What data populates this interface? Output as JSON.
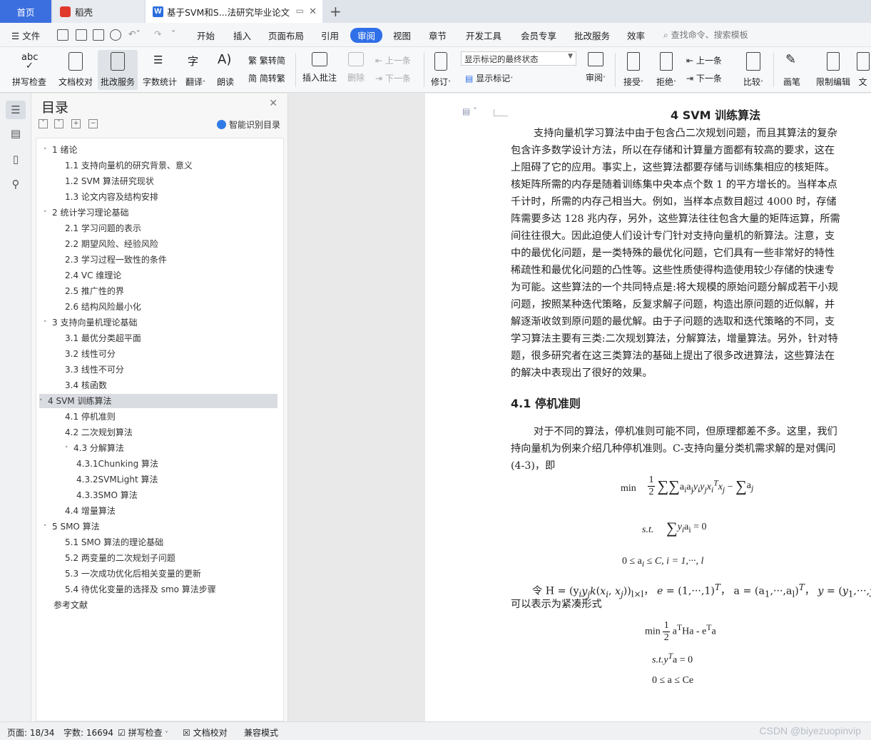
{
  "tabs": {
    "home": "首页",
    "wps": "稻壳",
    "doc": "基于SVM和S...法研究毕业论文"
  },
  "menu": {
    "file": "文件",
    "items": [
      "开始",
      "插入",
      "页面布局",
      "引用",
      "审阅",
      "视图",
      "章节",
      "开发工具",
      "会员专享",
      "批改服务",
      "效率"
    ],
    "active": "审阅",
    "search": "查找命令、搜索模板"
  },
  "ribbon": {
    "spell_check": "拼写检查",
    "doc_proof": "文档校对",
    "revise_service": "批改服务",
    "word_count": "字数统计",
    "translate": "翻译",
    "read_aloud": "朗读",
    "to_traditional": "繁转简",
    "to_simplified": "简转繁",
    "insert_comment": "插入批注",
    "delete": "删除",
    "prev_comment": "上一条",
    "next_comment": "下一条",
    "track_changes": "修订",
    "markup_state": "显示标记的最终状态",
    "show_markup": "显示标记",
    "review": "审阅",
    "accept": "接受",
    "reject": "拒绝",
    "prev_change": "上一条",
    "next_change": "下一条",
    "compare": "比较",
    "pen": "画笔",
    "restrict": "限制编辑",
    "more": "文"
  },
  "toc": {
    "title": "目录",
    "smart": "智能识别目录",
    "items": [
      {
        "label": "1  绪论",
        "level": 1,
        "caret": "˅"
      },
      {
        "label": "1.1 支持向量机的研究背景、意义",
        "level": 2
      },
      {
        "label": "1.2 SVM 算法研究现状",
        "level": 2
      },
      {
        "label": "1.3  论文内容及结构安排",
        "level": 2
      },
      {
        "label": "2  统计学习理论基础",
        "level": 1,
        "caret": "˅"
      },
      {
        "label": "2.1  学习问题的表示",
        "level": 2
      },
      {
        "label": "2.2  期望风险、经验风险",
        "level": 2
      },
      {
        "label": "2.3  学习过程一致性的条件",
        "level": 2
      },
      {
        "label": "2.4 VC 维理论",
        "level": 2
      },
      {
        "label": "2.5  推广性的界",
        "level": 2
      },
      {
        "label": "2.6  结构风险最小化",
        "level": 2
      },
      {
        "label": "3  支持向量机理论基础",
        "level": 1,
        "caret": "˅"
      },
      {
        "label": "3.1  最优分类超平面",
        "level": 2
      },
      {
        "label": "3.2  线性可分",
        "level": 2
      },
      {
        "label": "3.3  线性不可分",
        "level": 2
      },
      {
        "label": "3.4  核函数",
        "level": 2
      },
      {
        "label": "4 SVM 训练算法",
        "level": 1,
        "caret": "˅",
        "highlight": true
      },
      {
        "label": "4.1  停机准则",
        "level": 2
      },
      {
        "label": "4.2  二次规划算法",
        "level": 2
      },
      {
        "label": "4.3  分解算法",
        "level": 2,
        "caret": "˅"
      },
      {
        "label": "4.3.1Chunking 算法",
        "level": 3
      },
      {
        "label": "4.3.2SVMLight 算法",
        "level": 3
      },
      {
        "label": "4.3.3SMO 算法",
        "level": 3
      },
      {
        "label": "4.4  增量算法",
        "level": 2
      },
      {
        "label": "5 SMO 算法",
        "level": 1,
        "caret": "˅"
      },
      {
        "label": "5.1 SMO 算法的理论基础",
        "level": 2
      },
      {
        "label": "5.2  两变量的二次规划子问题",
        "level": 2
      },
      {
        "label": "5.3  一次成功优化后相关变量的更新",
        "level": 2
      },
      {
        "label": "5.4  待优化变量的选择及 smo 算法步骤",
        "level": 2
      },
      {
        "label": "参考文献",
        "level": 0
      }
    ]
  },
  "doc": {
    "heading": "4 SVM 训练算法",
    "para1": [
      "支持向量机学习算法中由于包含凸二次规划问题，而且其算法的复杂",
      "包含许多数学设计方法，所以在存储和计算量方面都有较高的要求，这在",
      "上阻碍了它的应用。事实上，这些算法都要存储与训练集相应的核矩阵。",
      "核矩阵所需的内存是随着训练集中央本点个数 1 的平方增长的。当样本点",
      "千计时，所需的内存己相当大。例如，当样本点数目超过 4000 时，存储",
      "阵需要多达 128 兆内存，另外，这些算法往往包含大量的矩阵运算，所需",
      "间往往很大。因此迫使人们设计专门针对支持向量机的新算法。注意，支",
      "中的最优化问题，是一类特殊的最优化问题，它们具有一些非常好的特性",
      "稀疏性和最优化问题的凸性等。这些性质使得构造使用较少存储的快速专",
      "为可能。这些算法的一个共同特点是:将大规模的原始问题分解成若干小规",
      "问题，按照某种迭代策略，反复求解子问题，构造出原问题的近似解，并",
      "解逐渐收敛到原问题的最优解。由于子问题的选取和迭代策略的不同，支",
      "学习算法主要有三类:二次规划算法，分解算法，增量算法。另外，针对特",
      "题，很多研究者在这三类算法的基础上提出了很多改进算法，这些算法在",
      "的解决中表现出了很好的效果。"
    ],
    "subheading": "4.1  停机准则",
    "para2": [
      "对于不同的算法，停机准则可能不同，但原理都差不多。这里，我们",
      "持向量机为例来介绍几种停机准则。C-支持向量分类机需求解的是对偶问",
      "(4-3)，即"
    ],
    "eq_min": "min",
    "eq_st": "s.t.",
    "eq_c": "0 ≤ a",
    "eq_c2": " ≤ C, i = 1,···, l",
    "let_line": "令 H = (y",
    "compact": "可以表示为紧凑形式",
    "eq2_min": "min",
    "eq2_st": "s.t.y",
    "eq2_c": "0 ≤ a ≤ Ce"
  },
  "status": {
    "page": "页面: 18/34",
    "words": "字数: 16694",
    "spell": "拼写检查",
    "proof": "文档校对",
    "compat": "兼容模式"
  },
  "watermark": "CSDN @biyezuopinvip"
}
